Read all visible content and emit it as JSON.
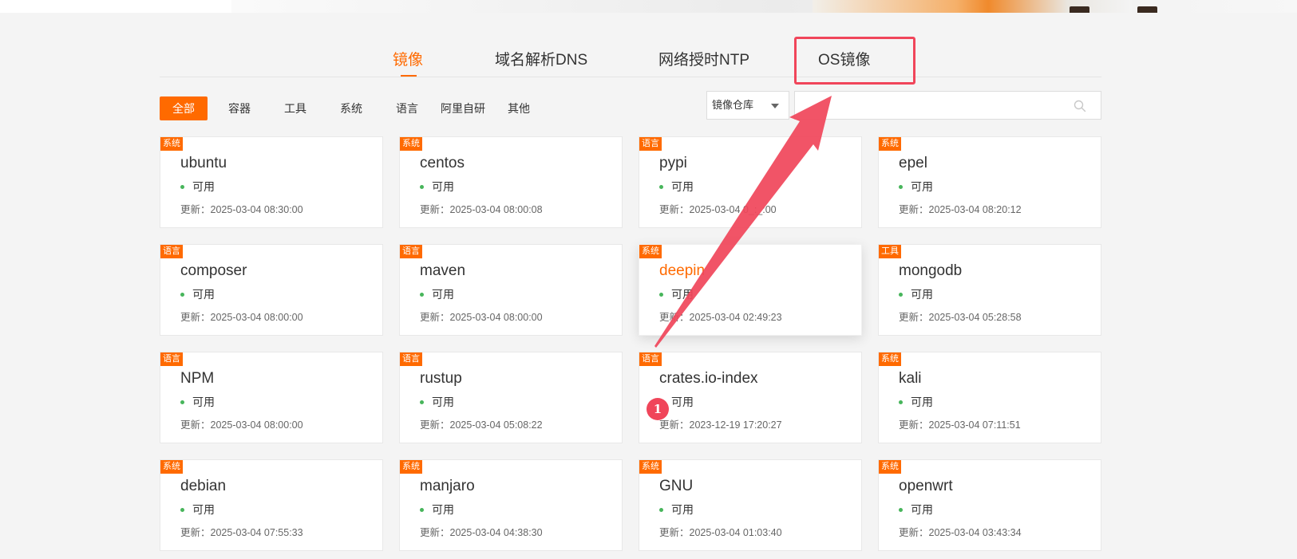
{
  "tabs": [
    {
      "label": "镜像",
      "active": true
    },
    {
      "label": "域名解析DNS",
      "active": false
    },
    {
      "label": "网络授时NTP",
      "active": false
    },
    {
      "label": "OS镜像",
      "active": false
    }
  ],
  "filters": [
    {
      "label": "全部",
      "active": true
    },
    {
      "label": "容器",
      "active": false
    },
    {
      "label": "工具",
      "active": false
    },
    {
      "label": "系统",
      "active": false
    },
    {
      "label": "语言",
      "active": false
    },
    {
      "label": "阿里自研",
      "active": false
    },
    {
      "label": "其他",
      "active": false
    }
  ],
  "search": {
    "select_value": "镜像仓库",
    "placeholder": ""
  },
  "colors": {
    "accent": "#ff6a00",
    "status_ok": "#47b55b",
    "annotation": "#f0455a"
  },
  "status_label": "可用",
  "updated_prefix": "更新：",
  "cards": [
    {
      "badge": "系统",
      "name": "ubuntu",
      "updated": "2025-03-04 08:30:00"
    },
    {
      "badge": "系统",
      "name": "centos",
      "updated": "2025-03-04 08:00:08"
    },
    {
      "badge": "语言",
      "name": "pypi",
      "updated": "2025-03-04 0_:_:00"
    },
    {
      "badge": "系统",
      "name": "epel",
      "updated": "2025-03-04 08:20:12"
    },
    {
      "badge": "语言",
      "name": "composer",
      "updated": "2025-03-04 08:00:00"
    },
    {
      "badge": "语言",
      "name": "maven",
      "updated": "2025-03-04 08:00:00"
    },
    {
      "badge": "系统",
      "name": "deepin",
      "updated": "2025-03-04 02:49:23",
      "hover": true
    },
    {
      "badge": "工具",
      "name": "mongodb",
      "updated": "2025-03-04 05:28:58"
    },
    {
      "badge": "语言",
      "name": "NPM",
      "updated": "2025-03-04 08:00:00"
    },
    {
      "badge": "语言",
      "name": "rustup",
      "updated": "2025-03-04 05:08:22"
    },
    {
      "badge": "语言",
      "name": "crates.io-index",
      "updated": "2023-12-19 17:20:27"
    },
    {
      "badge": "系统",
      "name": "kali",
      "updated": "2025-03-04 07:11:51"
    },
    {
      "badge": "系统",
      "name": "debian",
      "updated": "2025-03-04 07:55:33"
    },
    {
      "badge": "系统",
      "name": "manjaro",
      "updated": "2025-03-04 04:38:30"
    },
    {
      "badge": "系统",
      "name": "GNU",
      "updated": "2025-03-04 01:03:40"
    },
    {
      "badge": "系统",
      "name": "openwrt",
      "updated": "2025-03-04 03:43:34"
    }
  ],
  "annotation": {
    "step": "1"
  }
}
